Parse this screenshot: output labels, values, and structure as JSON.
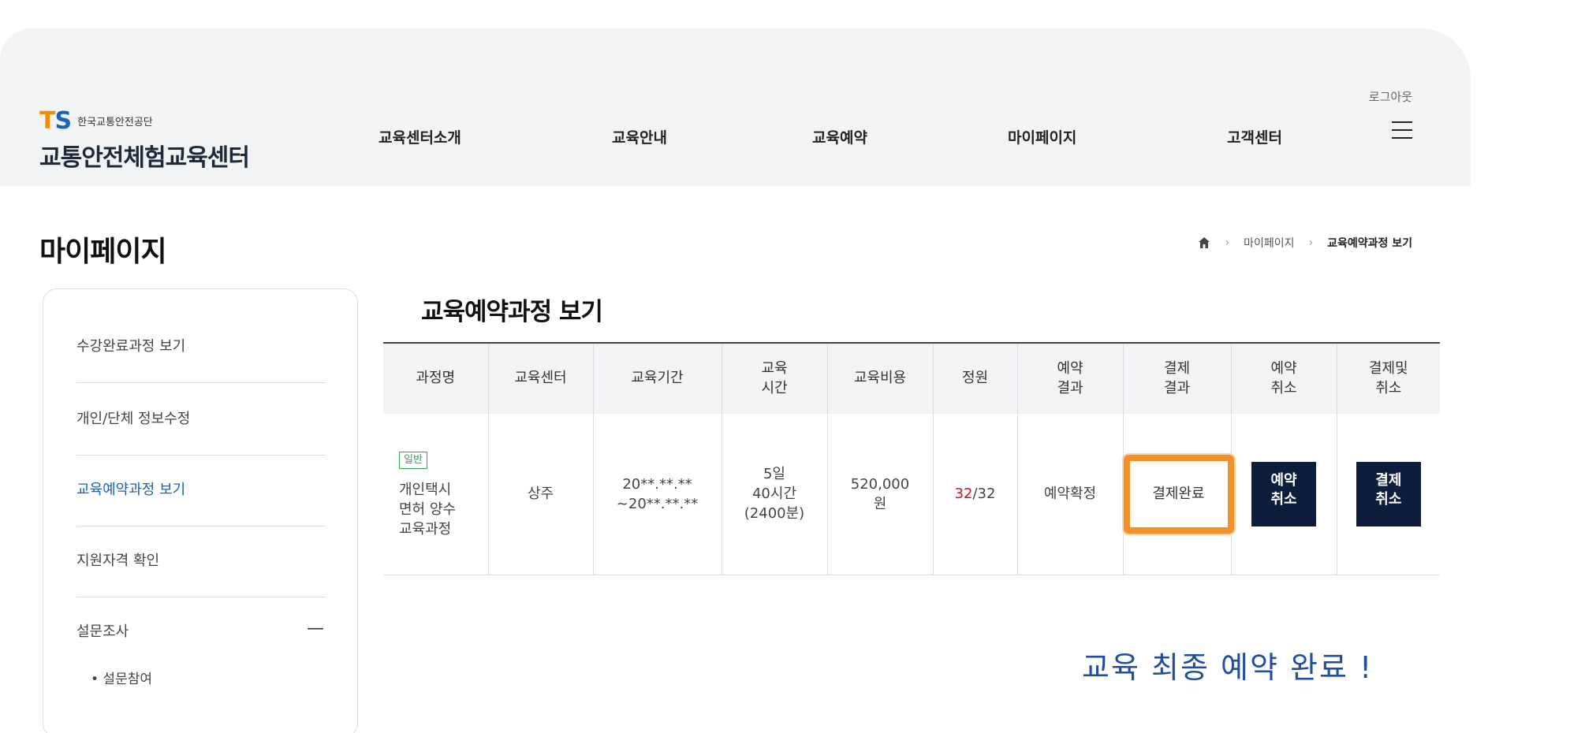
{
  "header": {
    "logo_ts_t": "T",
    "logo_ts_s": "S",
    "logo_org": "한국교통안전공단",
    "logo_title": "교통안전체험교육센터",
    "logout": "로그아웃",
    "nav": [
      "교육센터소개",
      "교육안내",
      "교육예약",
      "마이페이지",
      "고객센터"
    ]
  },
  "page": {
    "title": "마이페이지",
    "breadcrumb": [
      "마이페이지",
      "교육예약과정 보기"
    ],
    "breadcrumb_sep": "›",
    "section_title": "교육예약과정 보기"
  },
  "sidebar": {
    "items": [
      "수강완료과정 보기",
      "개인/단체 정보수정",
      "교육예약과정 보기",
      "지원자격 확인",
      "설문조사"
    ],
    "collapse_symbol": "—",
    "sub_items": [
      "• 설문참여"
    ]
  },
  "table": {
    "headers": [
      [
        "과정명"
      ],
      [
        "교육센터"
      ],
      [
        "교육기간"
      ],
      [
        "교육",
        "시간"
      ],
      [
        "교육비용"
      ],
      [
        "정원"
      ],
      [
        "예약",
        "결과"
      ],
      [
        "결제",
        "결과"
      ],
      [
        "예약",
        "취소"
      ],
      [
        "결제및",
        "취소"
      ]
    ],
    "row": {
      "badge": "일반",
      "course_lines": [
        "개인택시",
        "면허 양수",
        "교육과정"
      ],
      "center": "상주",
      "period_lines": [
        "20**.**.**",
        "~20**.**.**"
      ],
      "hours_lines": [
        "5일",
        "40시간",
        "(2400분)"
      ],
      "cost_lines": [
        "520,000",
        "원"
      ],
      "capacity_current": "32",
      "capacity_total": "/32",
      "reservation_result": "예약확정",
      "payment_result": "결제완료",
      "cancel_reservation_lines": [
        "예약",
        "취소"
      ],
      "cancel_payment_lines": [
        "결제",
        "취소"
      ]
    }
  },
  "annotation": "교육 최종 예약 완료 !",
  "colors": {
    "brand_orange": "#f28c00",
    "brand_blue": "#1a64b4",
    "highlight": "#f2902b",
    "navy_button": "#0d1e3c",
    "capacity_red": "#d0121b",
    "badge_green": "#2fa84f"
  }
}
